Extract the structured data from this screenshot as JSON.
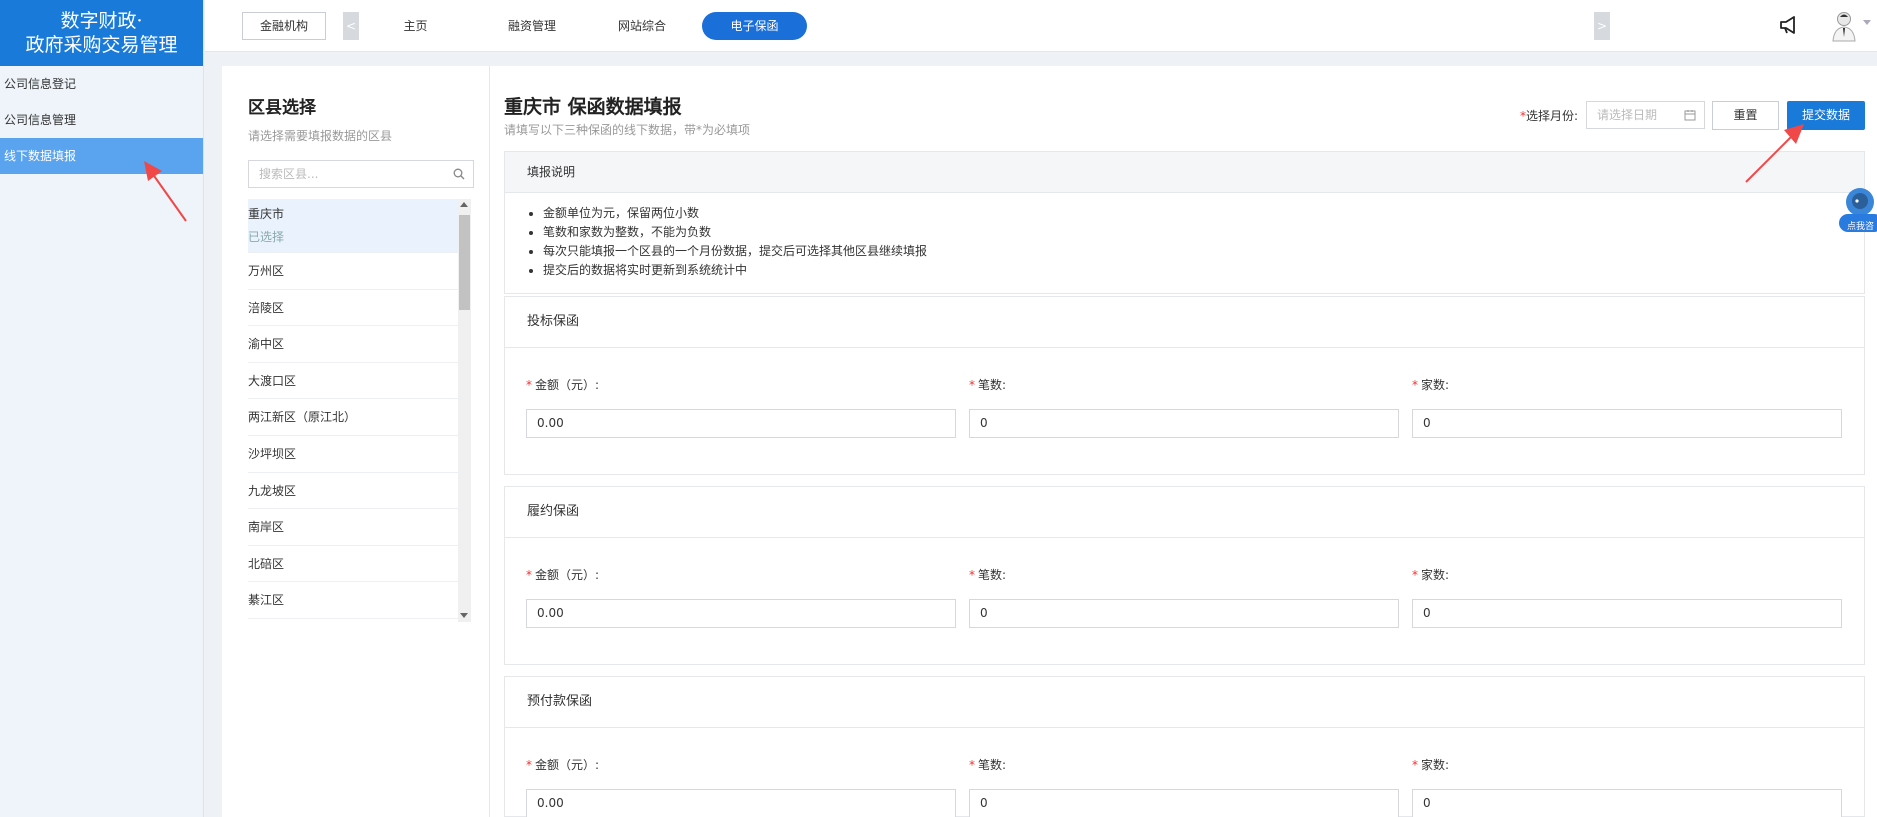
{
  "sidebar": {
    "brand_line1": "数字财政·",
    "brand_line2": "政府采购交易管理",
    "items": [
      {
        "label": "公司信息登记"
      },
      {
        "label": "公司信息管理"
      },
      {
        "label": "线下数据填报"
      }
    ]
  },
  "topbar": {
    "institution_button": "金融机构",
    "prev_arrow": "<",
    "next_arrow": ">",
    "tabs": [
      {
        "label": "主页"
      },
      {
        "label": "融资管理"
      },
      {
        "label": "网站综合"
      },
      {
        "label": "电子保函"
      }
    ]
  },
  "district": {
    "title": "区县选择",
    "hint": "请选择需要填报数据的区县",
    "search_placeholder": "搜索区县...",
    "selected": {
      "name": "重庆市",
      "status": "已选择"
    },
    "items": [
      {
        "name": "万州区"
      },
      {
        "name": "涪陵区"
      },
      {
        "name": "渝中区"
      },
      {
        "name": "大渡口区"
      },
      {
        "name": "两江新区（原江北）"
      },
      {
        "name": "沙坪坝区"
      },
      {
        "name": "九龙坡区"
      },
      {
        "name": "南岸区"
      },
      {
        "name": "北碚区"
      },
      {
        "name": "綦江区"
      }
    ]
  },
  "form": {
    "title": "重庆市 保函数据填报",
    "subtitle": "请填写以下三种保函的线下数据，带*为必填项",
    "month_label_req": "*",
    "month_label": "选择月份:",
    "date_placeholder": "请选择日期",
    "reset_button": "重置",
    "submit_button": "提交数据",
    "notes": {
      "heading": "填报说明",
      "items": [
        "金额单位为元，保留两位小数",
        "笔数和家数为整数，不能为负数",
        "每次只能填报一个区县的一个月份数据，提交后可选择其他区县继续填报",
        "提交后的数据将实时更新到系统统计中"
      ]
    },
    "sections": [
      {
        "title": "投标保函",
        "amount_label": "金额（元）:",
        "count_label": "笔数:",
        "companies_label": "家数:",
        "amount": "0.00",
        "count": "0",
        "companies": "0"
      },
      {
        "title": "履约保函",
        "amount_label": "金额（元）:",
        "count_label": "笔数:",
        "companies_label": "家数:",
        "amount": "0.00",
        "count": "0",
        "companies": "0"
      },
      {
        "title": "预付款保函",
        "amount_label": "金额（元）:",
        "count_label": "笔数:",
        "companies_label": "家数:",
        "amount": "0.00",
        "count": "0",
        "companies": "0"
      }
    ]
  },
  "widget": {
    "label": "点我咨"
  },
  "colors": {
    "brand": "#1a7ad9",
    "sidebar_active": "#5aa3ef",
    "annotation": "#f04848",
    "required": "#e33333"
  }
}
